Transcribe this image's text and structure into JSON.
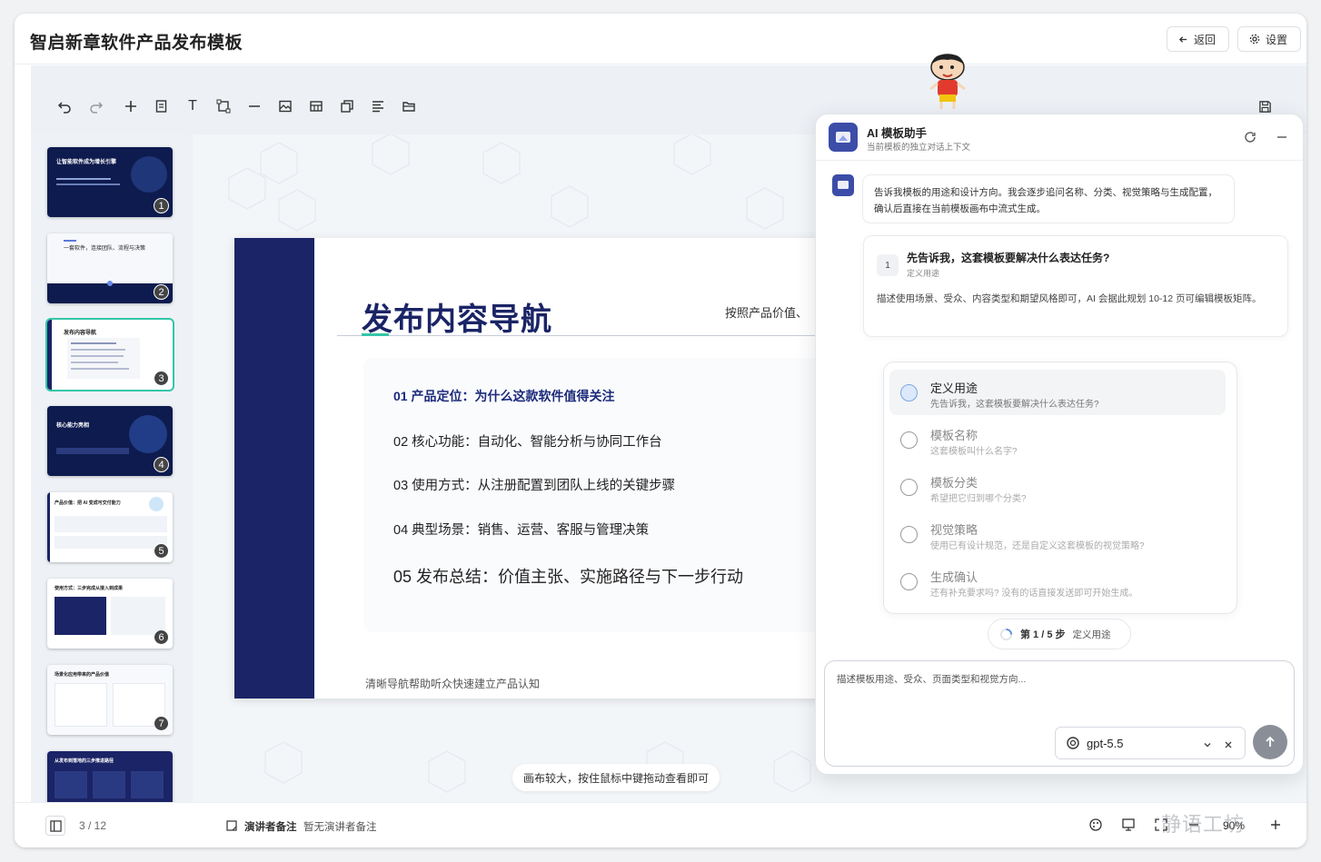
{
  "app": {
    "title": "智启新章软件产品发布模板",
    "back_label": "返回",
    "settings_label": "设置"
  },
  "toolbar": {
    "icons": [
      "undo-icon",
      "redo-icon",
      "add-icon",
      "page-icon",
      "text-icon",
      "shape-icon",
      "line-icon",
      "image-icon",
      "table-icon",
      "copy-icon",
      "align-icon",
      "folder-icon",
      "save-icon"
    ]
  },
  "thumbnails": [
    {
      "num": "1",
      "title": "让智能软件成为增长引擎",
      "theme": "dark"
    },
    {
      "num": "2",
      "title": "一套软件，连接团队、流程与决策",
      "theme": "light"
    },
    {
      "num": "3",
      "title": "发布内容导航",
      "theme": "light"
    },
    {
      "num": "4",
      "title": "核心能力亮相",
      "theme": "dark"
    },
    {
      "num": "5",
      "title": "产品价值：把 AI 变成可交付能力",
      "theme": "light"
    },
    {
      "num": "6",
      "title": "使用方式：三步完成从接入到成果",
      "theme": "light"
    },
    {
      "num": "7",
      "title": "场景化应用带来的产品价值",
      "theme": "light"
    },
    {
      "num": "8",
      "title": "从发布到落地的三步推进路径",
      "theme": "dark"
    }
  ],
  "slide": {
    "title": "发布内容导航",
    "side_note": "按照产品价值、",
    "items": [
      "01 产品定位：为什么这款软件值得关注",
      "02 核心功能：自动化、智能分析与协同工作台",
      "03 使用方式：从注册配置到团队上线的关键步骤",
      "04 典型场景：销售、运营、客服与管理决策",
      "05 发布总结：价值主张、实施路径与下一步行动"
    ],
    "footer": "清晰导航帮助听众快速建立产品认知"
  },
  "canvas_hint": "画布较大，按住鼠标中键拖动查看即可",
  "assistant": {
    "title": "AI 模板助手",
    "subtitle": "当前模板的独立对话上下文",
    "message": "告诉我模板的用途和设计方向。我会逐步追问名称、分类、视觉策略与生成配置，确认后直接在当前模板画布中流式生成。",
    "question": {
      "num": "1",
      "title": "先告诉我，这套模板要解决什么表达任务?",
      "tag": "定义用途",
      "desc": "描述使用场景、受众、内容类型和期望风格即可，AI 会据此规划 10-12 页可编辑模板矩阵。"
    },
    "steps": [
      {
        "title": "定义用途",
        "sub": "先告诉我，这套模板要解决什么表达任务?"
      },
      {
        "title": "模板名称",
        "sub": "这套模板叫什么名字?"
      },
      {
        "title": "模板分类",
        "sub": "希望把它归到哪个分类?"
      },
      {
        "title": "视觉策略",
        "sub": "使用已有设计规范，还是自定义这套模板的视觉策略?"
      },
      {
        "title": "生成确认",
        "sub": "还有补充要求吗? 没有的话直接发送即可开始生成。"
      }
    ],
    "progress": {
      "label": "第 1 / 5 步",
      "current": "定义用途"
    },
    "input_placeholder": "描述模板用途、受众、页面类型和视觉方向...",
    "model": "gpt-5.5"
  },
  "statusbar": {
    "page": "3 / 12",
    "notes_label": "演讲者备注",
    "notes_value": "暂无演讲者备注",
    "zoom": "90%",
    "watermark": "静语工坊"
  },
  "colors": {
    "navy": "#1a2466",
    "accent": "#1b2a7a",
    "teal": "#33c6a8",
    "highlight": "#4a9ce8"
  }
}
